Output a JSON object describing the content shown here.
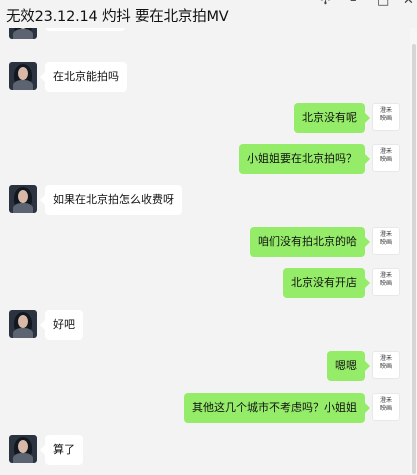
{
  "window": {
    "title": "无效23.12.14 灼抖 要在北京拍MV",
    "controls": {
      "pin": "✢",
      "minimize": "–",
      "maximize": "□",
      "close": "✕"
    }
  },
  "brand_avatar_text": "澄禾\n映画",
  "messages": [
    {
      "side": "left",
      "text": "在北京能拍吗"
    },
    {
      "side": "right",
      "text": "北京没有呢"
    },
    {
      "side": "right",
      "text": "小姐姐要在北京拍吗？"
    },
    {
      "side": "left",
      "text": "如果在北京拍怎么收费呀"
    },
    {
      "side": "right",
      "text": "咱们没有拍北京的哈"
    },
    {
      "side": "right",
      "text": "北京没有开店"
    },
    {
      "side": "left",
      "text": "好吧"
    },
    {
      "side": "right",
      "text": "嗯嗯"
    },
    {
      "side": "right",
      "text": "其他这几个城市不考虑吗？小姐姐"
    },
    {
      "side": "left",
      "text": "算了"
    }
  ],
  "colors": {
    "sent_bubble": "#95ec69",
    "received_bubble": "#ffffff",
    "background": "#f3f3f3"
  }
}
